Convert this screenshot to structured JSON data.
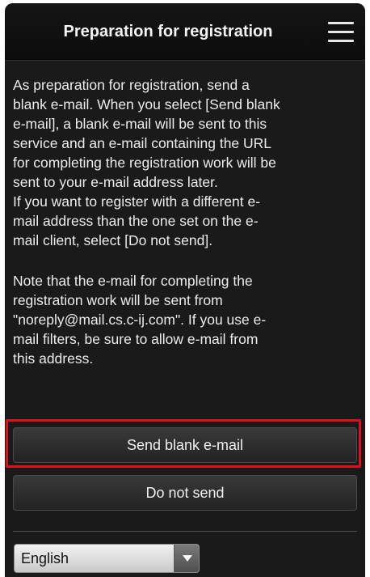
{
  "header": {
    "title": "Preparation for registration",
    "menu_icon": "hamburger-menu-icon"
  },
  "content": {
    "paragraph_1": "As preparation for registration, send a\nblank e-mail. When you select [Send blank\ne-mail], a blank e-mail will be sent to this\nservice and an e-mail containing the URL\nfor completing the registration work will be\nsent to your e-mail address later.\nIf you want to register with a different e-\nmail address than the one set on the e-\nmail client, select [Do not send].",
    "paragraph_2": "Note that the e-mail for completing the\nregistration work will be sent from\n\"noreply@mail.cs.c-ij.com\". If you use e-\nmail filters, be sure to allow e-mail from\nthis address."
  },
  "buttons": {
    "send_label": "Send blank e-mail",
    "do_not_send_label": "Do not send"
  },
  "language": {
    "selected": "English",
    "arrow_icon": "chevron-down-icon"
  },
  "colors": {
    "background": "#1a1a1a",
    "highlight": "#e0101a",
    "text": "#ececec"
  }
}
